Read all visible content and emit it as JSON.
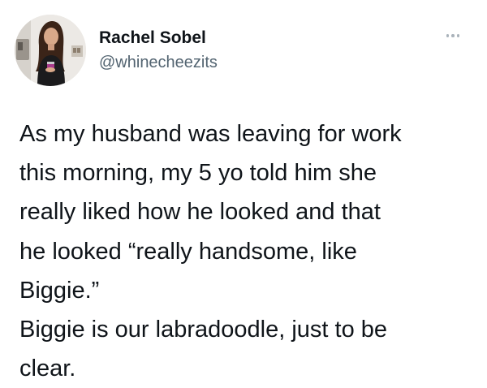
{
  "author": {
    "display_name": "Rachel Sobel",
    "handle": "@whinecheezits",
    "avatar_icon": "profile-photo"
  },
  "menu": {
    "icon": "more-options-icon"
  },
  "tweet": {
    "lines": [
      "As my husband was leaving for work",
      "this morning, my 5 yo told him she",
      "really liked how he looked and that",
      "he looked “really handsome, like",
      "Biggie.”",
      "Biggie is our labradoodle, just to be",
      "clear."
    ]
  },
  "colors": {
    "text": "#0f1419",
    "secondary_text": "#536471",
    "menu_dots": "#aab3bb",
    "background": "#ffffff"
  }
}
